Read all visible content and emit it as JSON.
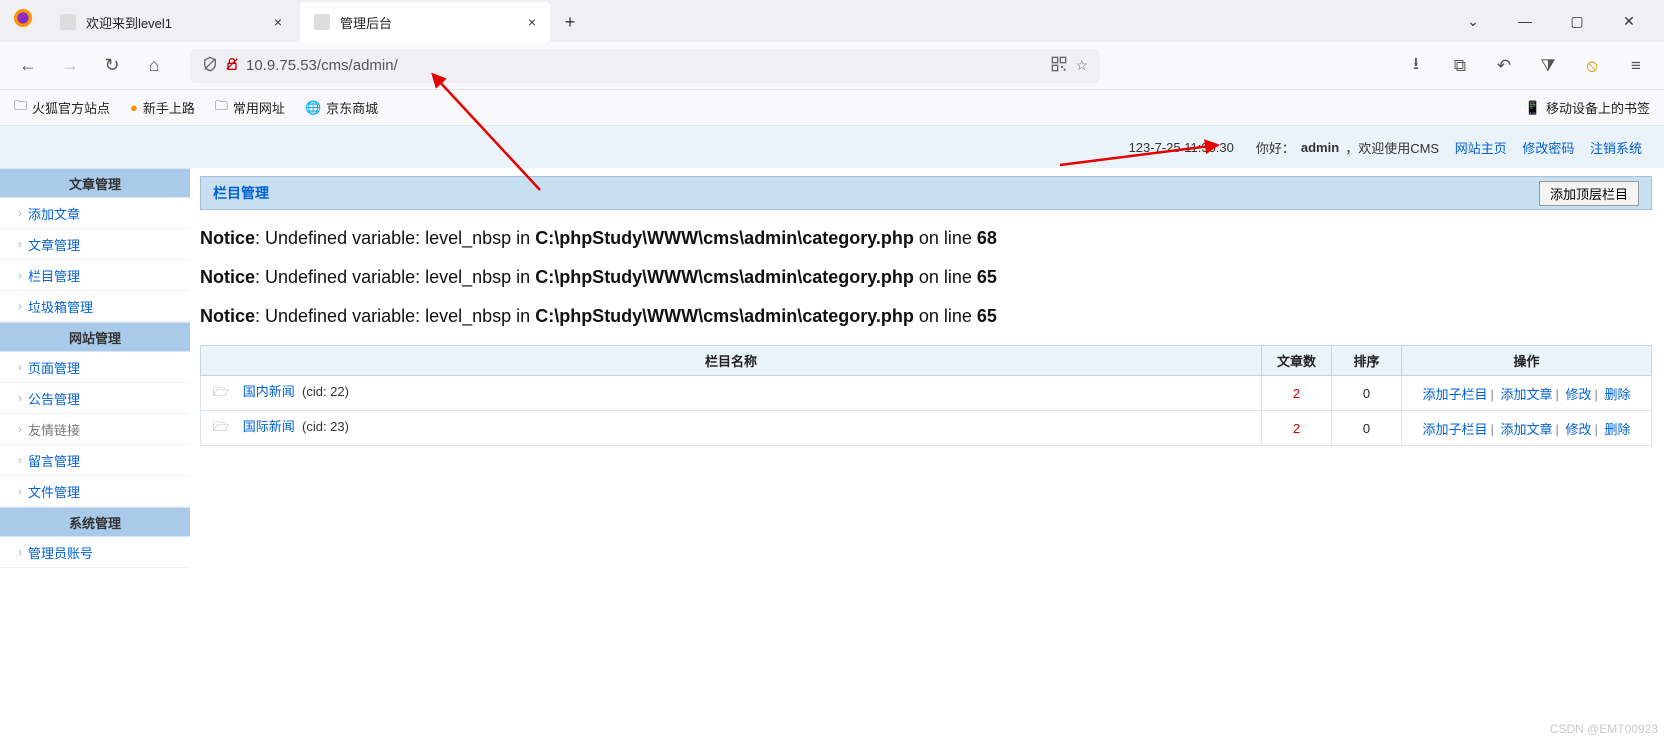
{
  "browser": {
    "tabs": [
      {
        "title": "欢迎来到level1"
      },
      {
        "title": "管理后台"
      }
    ],
    "url": "10.9.75.53/cms/admin/",
    "bookmarks": [
      {
        "label": "火狐官方站点"
      },
      {
        "label": "新手上路"
      },
      {
        "label": "常用网址"
      },
      {
        "label": "京东商城"
      }
    ],
    "mobile_bookmarks": "移动设备上的书签"
  },
  "header": {
    "datetime": "123-7-25 11:35:30",
    "hello_label": "你好：",
    "username": "admin",
    "welcome_suffix": "，欢迎使用CMS",
    "link_home": "网站主页",
    "link_pwd": "修改密码",
    "link_logout": "注销系统"
  },
  "sidebar": {
    "groups": [
      {
        "title": "文章管理",
        "items": [
          "添加文章",
          "文章管理",
          "栏目管理",
          "垃圾箱管理"
        ]
      },
      {
        "title": "网站管理",
        "items": [
          "页面管理",
          "公告管理",
          "友情链接",
          "留言管理",
          "文件管理"
        ]
      },
      {
        "title": "系统管理",
        "items": [
          "管理员账号"
        ]
      }
    ]
  },
  "panel": {
    "title": "栏目管理",
    "add_button": "添加顶层栏目"
  },
  "notices": [
    {
      "prefix": "Notice",
      "msg": ": Undefined variable: level_nbsp in ",
      "file": "C:\\phpStudy\\WWW\\cms\\admin\\category.php",
      "online": " on line ",
      "line": "68"
    },
    {
      "prefix": "Notice",
      "msg": ": Undefined variable: level_nbsp in ",
      "file": "C:\\phpStudy\\WWW\\cms\\admin\\category.php",
      "online": " on line ",
      "line": "65"
    },
    {
      "prefix": "Notice",
      "msg": ": Undefined variable: level_nbsp in ",
      "file": "C:\\phpStudy\\WWW\\cms\\admin\\category.php",
      "online": " on line ",
      "line": "65"
    }
  ],
  "table": {
    "headers": {
      "name": "栏目名称",
      "count": "文章数",
      "sort": "排序",
      "ops": "操作"
    },
    "ops": {
      "addsub": "添加子栏目",
      "addart": "添加文章",
      "edit": "修改",
      "del": "删除"
    },
    "rows": [
      {
        "name": "国内新闻",
        "cid": "(cid: 22)",
        "count": "2",
        "sort": "0"
      },
      {
        "name": "国际新闻",
        "cid": "(cid: 23)",
        "count": "2",
        "sort": "0"
      }
    ]
  },
  "watermark": "CSDN @EMT00923"
}
